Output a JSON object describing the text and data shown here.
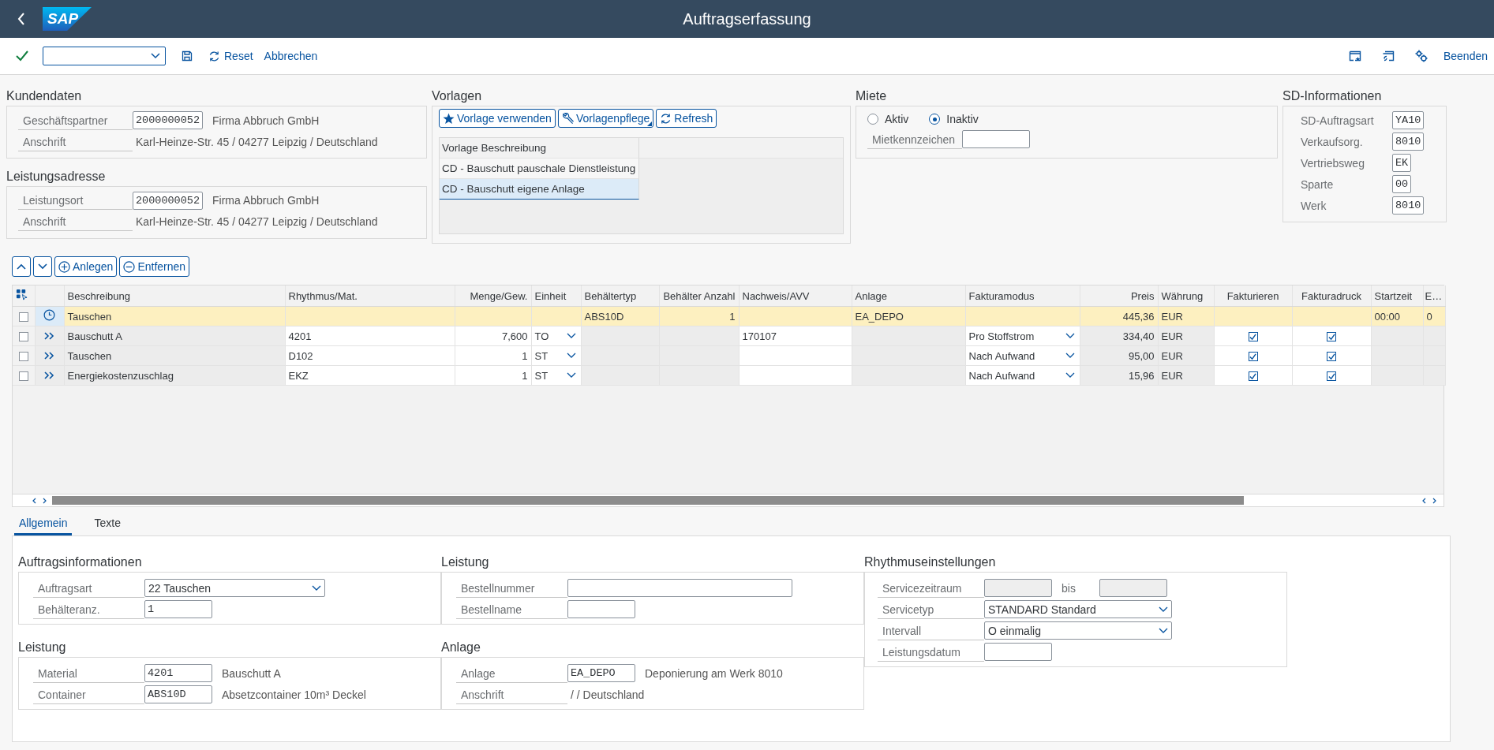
{
  "header": {
    "logo": "SAP",
    "title": "Auftragserfassung"
  },
  "toolbar": {
    "reset": "Reset",
    "cancel": "Abbrechen",
    "exit": "Beenden"
  },
  "kundendaten": {
    "title": "Kundendaten",
    "fields": [
      {
        "label": "Geschäftspartner",
        "kind": "input",
        "value": "2000000052",
        "text": "Firma Abbruch GmbH"
      },
      {
        "label": "Anschrift",
        "kind": "display",
        "value": "Karl-Heinze-Str. 45 / 04277 Leipzig / Deutschland"
      }
    ]
  },
  "leistungsadresse": {
    "title": "Leistungsadresse",
    "fields": [
      {
        "label": "Leistungsort",
        "kind": "input",
        "value": "2000000052",
        "text": "Firma Abbruch GmbH"
      },
      {
        "label": "Anschrift",
        "kind": "display",
        "value": "Karl-Heinze-Str. 45 / 04277 Leipzig / Deutschland"
      }
    ]
  },
  "vorlagen": {
    "title": "Vorlagen",
    "buttons": [
      {
        "label": "Vorlage verwenden",
        "kind": "star",
        "menu": false
      },
      {
        "label": "Vorlagenpflege",
        "kind": "wrench",
        "menu": true
      },
      {
        "label": "Refresh",
        "kind": "refresh",
        "menu": false
      }
    ],
    "column": "Vorlage Beschreibung",
    "rows": [
      {
        "text": "CD - Bauschutt pauschale Dienstleistung",
        "selected": false
      },
      {
        "text": "CD - Bauschutt eigene Anlage",
        "selected": true
      }
    ]
  },
  "miete": {
    "title": "Miete",
    "options": [
      {
        "label": "Aktiv",
        "selected": false
      },
      {
        "label": "Inaktiv",
        "selected": true
      }
    ],
    "fields": [
      {
        "label": "Mietkennzeichen",
        "kind": "input"
      }
    ]
  },
  "sd_informationen": {
    "title": "SD-Informationen",
    "fields": [
      {
        "label": "SD-Auftragsart",
        "kind": "input",
        "value": "YA10"
      },
      {
        "label": "Verkaufsorg.",
        "kind": "input",
        "value": "8010"
      },
      {
        "label": "Vertriebsweg",
        "kind": "input",
        "value": "EK"
      },
      {
        "label": "Sparte",
        "kind": "input",
        "value": "00"
      },
      {
        "label": "Werk",
        "kind": "input",
        "value": "8010"
      }
    ]
  },
  "table_toolbar": {
    "buttons": [
      {
        "kind": "up"
      },
      {
        "kind": "down"
      },
      {
        "kind": "add",
        "label": "Anlegen"
      },
      {
        "kind": "remove",
        "label": "Entfernen"
      }
    ]
  },
  "table": {
    "columns": [
      {
        "label": "Beschreibung",
        "kind": "text",
        "editable": false
      },
      {
        "label": "Rhythmus/Mat.",
        "kind": "text",
        "editable": true
      },
      {
        "label": "Menge/Gew.",
        "kind": "number",
        "editable": true
      },
      {
        "label": "Einheit",
        "kind": "dropdown",
        "editable": true
      },
      {
        "label": "Behältertyp",
        "kind": "text",
        "editable": false
      },
      {
        "label": "Behälter Anzahl",
        "kind": "number",
        "editable": false
      },
      {
        "label": "Nachweis/AVV",
        "kind": "text",
        "editable": true
      },
      {
        "label": "Anlage",
        "kind": "text",
        "editable": false
      },
      {
        "label": "Fakturamodus",
        "kind": "dropdown",
        "editable": true
      },
      {
        "label": "Preis",
        "kind": "number",
        "editable": false
      },
      {
        "label": "Währung",
        "kind": "text",
        "editable": false
      },
      {
        "label": "Fakturieren",
        "kind": "check",
        "editable": true
      },
      {
        "label": "Fakturadruck",
        "kind": "check",
        "editable": true
      },
      {
        "label": "Startzeit",
        "kind": "text",
        "editable": false
      },
      {
        "label": "E…",
        "kind": "text",
        "editable": false
      }
    ],
    "rows": [
      {
        "kind": "header",
        "selected": false,
        "cells": [
          "Tauschen",
          null,
          null,
          null,
          "ABS10D",
          "1",
          null,
          "EA_DEPO",
          null,
          "445,36",
          "EUR",
          null,
          null,
          "00:00",
          "0"
        ]
      },
      {
        "kind": "item",
        "selected": false,
        "cells": [
          "Bauschutt A",
          "4201",
          "7,600",
          "TO",
          null,
          null,
          "170107",
          null,
          "Pro Stoffstrom",
          "334,40",
          "EUR",
          true,
          true,
          null,
          null
        ]
      },
      {
        "kind": "item",
        "selected": false,
        "cells": [
          "Tauschen",
          "D102",
          "1",
          "ST",
          null,
          null,
          null,
          null,
          "Nach Aufwand",
          "95,00",
          "EUR",
          true,
          true,
          null,
          null
        ]
      },
      {
        "kind": "item",
        "selected": false,
        "cells": [
          "Energiekostenzuschlag",
          "EKZ",
          "1",
          "ST",
          null,
          null,
          null,
          null,
          "Nach Aufwand",
          "15,96",
          "EUR",
          true,
          true,
          null,
          null
        ]
      }
    ]
  },
  "tabs": [
    {
      "label": "Allgemein",
      "selected": true
    },
    {
      "label": "Texte",
      "selected": false
    }
  ],
  "allgemein": {
    "auftragsinformationen": {
      "title": "Auftragsinformationen",
      "fields": [
        {
          "label": "Auftragsart",
          "kind": "dropdown",
          "value": "22 Tauschen"
        },
        {
          "label": "Behälteranz.",
          "kind": "input",
          "value": "1"
        }
      ]
    },
    "leistung": {
      "title": "Leistung",
      "fields": [
        {
          "label": "Bestellnummer",
          "kind": "wideinput"
        },
        {
          "label": "Bestellname",
          "kind": "input"
        }
      ]
    },
    "rhythmuseinstellungen": {
      "title": "Rhythmuseinstellungen",
      "fields": [
        {
          "label": "Servicezeitraum",
          "kind": "range",
          "separator": "bis",
          "disabled": true
        },
        {
          "label": "Servicetyp",
          "kind": "dropdown",
          "value": "STANDARD Standard"
        },
        {
          "label": "Intervall",
          "kind": "dropdown",
          "value": "O einmalig"
        },
        {
          "label": "Leistungsdatum",
          "kind": "input"
        }
      ]
    },
    "leistung_material": {
      "title": "Leistung",
      "fields": [
        {
          "label": "Material",
          "kind": "input",
          "value": "4201",
          "text": "Bauschutt A"
        },
        {
          "label": "Container",
          "kind": "input",
          "value": "ABS10D",
          "text": "Absetzcontainer 10m³ Deckel"
        }
      ]
    },
    "anlage": {
      "title": "Anlage",
      "fields": [
        {
          "label": "Anlage",
          "kind": "input",
          "value": "EA_DEPO",
          "text": "Deponierung am Werk 8010"
        },
        {
          "label": "Anschrift",
          "kind": "display",
          "value": "/ / Deutschland"
        }
      ]
    }
  }
}
